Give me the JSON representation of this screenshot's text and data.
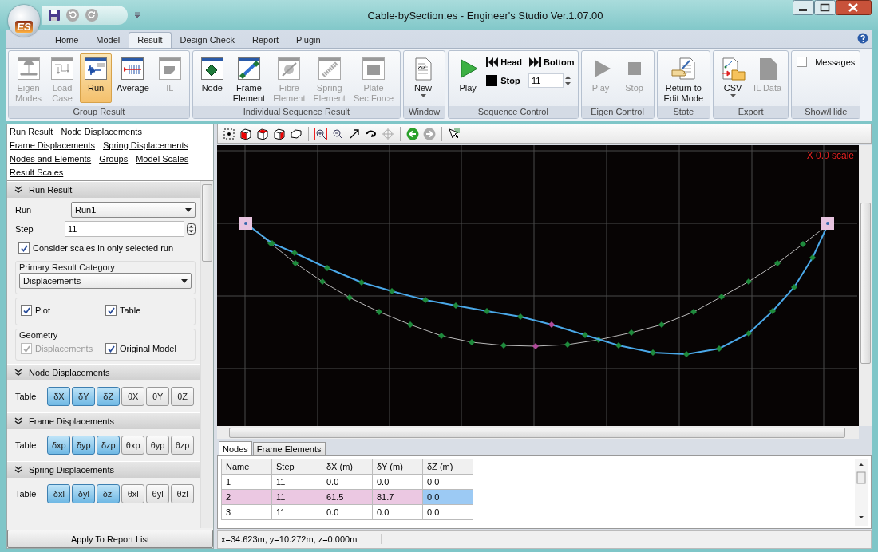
{
  "window": {
    "title": "Cable-bySection.es - Engineer's Studio Ver.1.07.00",
    "logo": "ES"
  },
  "ribbon_tabs": [
    {
      "label": "Home",
      "selected": false
    },
    {
      "label": "Model",
      "selected": false
    },
    {
      "label": "Result",
      "selected": true
    },
    {
      "label": "Design Check",
      "selected": false
    },
    {
      "label": "Report",
      "selected": false
    },
    {
      "label": "Plugin",
      "selected": false
    }
  ],
  "ribbon_groups": [
    {
      "label": "Group Result",
      "items": [
        {
          "kind": "large",
          "label": "Eigen\nModes",
          "disabled": true,
          "selected": false
        },
        {
          "kind": "large",
          "label": "Load\nCase",
          "disabled": true,
          "selected": false
        },
        {
          "kind": "large",
          "label": "Run",
          "disabled": false,
          "selected": true
        },
        {
          "kind": "large",
          "label": "Average",
          "disabled": false,
          "selected": false
        },
        {
          "kind": "large",
          "label": "IL",
          "disabled": true,
          "selected": false
        }
      ]
    },
    {
      "label": "Individual Sequence Result",
      "items": [
        {
          "kind": "large",
          "label": "Node",
          "disabled": false,
          "selected": false
        },
        {
          "kind": "large",
          "label": "Frame\nElement",
          "disabled": false,
          "selected": false
        },
        {
          "kind": "large",
          "label": "Fibre\nElement",
          "disabled": true,
          "selected": false
        },
        {
          "kind": "large",
          "label": "Spring\nElement",
          "disabled": true,
          "selected": false
        },
        {
          "kind": "large",
          "label": "Plate\nSec.Force",
          "disabled": true,
          "selected": false
        }
      ]
    },
    {
      "label": "Window",
      "items": [
        {
          "kind": "menu",
          "label": "New",
          "disabled": false,
          "selected": false
        }
      ]
    },
    {
      "label": "Sequence Control",
      "items": [
        {
          "kind": "large",
          "label": "Play",
          "disabled": false,
          "selected": false
        },
        {
          "kind": "small",
          "label": "Head",
          "disabled": false
        },
        {
          "kind": "small",
          "label": "Bottom",
          "disabled": false
        },
        {
          "kind": "small",
          "label": "Stop",
          "disabled": false
        },
        {
          "kind": "spin",
          "value": "11"
        }
      ]
    },
    {
      "label": "Eigen Control",
      "items": [
        {
          "kind": "large",
          "label": "Play",
          "disabled": true,
          "selected": false
        },
        {
          "kind": "large",
          "label": "Stop",
          "disabled": true,
          "selected": false
        }
      ]
    },
    {
      "label": "State",
      "items": [
        {
          "kind": "large",
          "label": "Return to\nEdit Mode",
          "disabled": false,
          "selected": false
        }
      ]
    },
    {
      "label": "Export",
      "items": [
        {
          "kind": "menu",
          "label": "CSV",
          "disabled": false,
          "selected": false
        },
        {
          "kind": "large",
          "label": "IL Data",
          "disabled": true,
          "selected": false
        }
      ]
    },
    {
      "label": "Show/Hide",
      "items": [
        {
          "kind": "check",
          "label": "Messages",
          "checked": false
        }
      ]
    }
  ],
  "side_links": [
    "Run Result",
    "Node Displacements",
    "Frame Displacements",
    "Spring Displacements",
    "Nodes and Elements",
    "Groups",
    "Model Scales",
    "Result Scales"
  ],
  "run_result": {
    "title": "Run Result",
    "run_label": "Run",
    "run_value": "Run1",
    "step_label": "Step",
    "step_value": "11",
    "consider_scales": {
      "label": "Consider scales in only selected run",
      "checked": true
    },
    "category_label": "Primary Result Category",
    "category_value": "Displacements",
    "plot": {
      "label": "Plot",
      "checked": true
    },
    "table": {
      "label": "Table",
      "checked": true
    },
    "geometry_label": "Geometry",
    "geometry": [
      {
        "label": "Displacements",
        "checked": true,
        "disabled": true
      },
      {
        "label": "Original Model",
        "checked": true,
        "disabled": false
      }
    ]
  },
  "toggle_sections": [
    {
      "title": "Node Displacements",
      "label": "Table",
      "toggles": [
        {
          "label": "δX",
          "on": true
        },
        {
          "label": "δY",
          "on": true
        },
        {
          "label": "δZ",
          "on": true
        },
        {
          "label": "θX",
          "on": false
        },
        {
          "label": "θY",
          "on": false
        },
        {
          "label": "θZ",
          "on": false
        }
      ]
    },
    {
      "title": "Frame Displacements",
      "label": "Table",
      "toggles": [
        {
          "label": "δxp",
          "on": true
        },
        {
          "label": "δyp",
          "on": true
        },
        {
          "label": "δzp",
          "on": true
        },
        {
          "label": "θxp",
          "on": false
        },
        {
          "label": "θyp",
          "on": false
        },
        {
          "label": "θzp",
          "on": false
        }
      ]
    },
    {
      "title": "Spring Displacements",
      "label": "Table",
      "toggles": [
        {
          "label": "δxl",
          "on": true
        },
        {
          "label": "δyl",
          "on": true
        },
        {
          "label": "δzl",
          "on": true
        },
        {
          "label": "θxl",
          "on": false
        },
        {
          "label": "θyl",
          "on": false
        },
        {
          "label": "θzl",
          "on": false
        }
      ]
    }
  ],
  "apply_button": "Apply To Report List",
  "viewport": {
    "scale_label": "X 0.0 scale"
  },
  "result_tabs": [
    {
      "label": "Nodes",
      "selected": true
    },
    {
      "label": "Frame Elements",
      "selected": false
    }
  ],
  "table": {
    "columns": [
      "Name",
      "Step",
      "δX (m)",
      "δY (m)",
      "δZ (m)"
    ],
    "rows": [
      {
        "selected": false,
        "cells": [
          {
            "text": "1",
            "focused": false
          },
          {
            "text": "11",
            "focused": false
          },
          {
            "text": "0.0",
            "focused": false
          },
          {
            "text": "0.0",
            "focused": false
          },
          {
            "text": "0.0",
            "focused": false
          }
        ]
      },
      {
        "selected": true,
        "cells": [
          {
            "text": "2",
            "focused": false
          },
          {
            "text": "11",
            "focused": false
          },
          {
            "text": "61.5",
            "focused": false
          },
          {
            "text": "81.7",
            "focused": false
          },
          {
            "text": "0.0",
            "focused": true
          }
        ]
      },
      {
        "selected": false,
        "cells": [
          {
            "text": "3",
            "focused": false
          },
          {
            "text": "11",
            "focused": false
          },
          {
            "text": "0.0",
            "focused": false
          },
          {
            "text": "0.0",
            "focused": false
          },
          {
            "text": "0.0",
            "focused": false
          }
        ]
      }
    ]
  },
  "status_bar": "x=34.623m, y=10.272m, z=0.000m"
}
